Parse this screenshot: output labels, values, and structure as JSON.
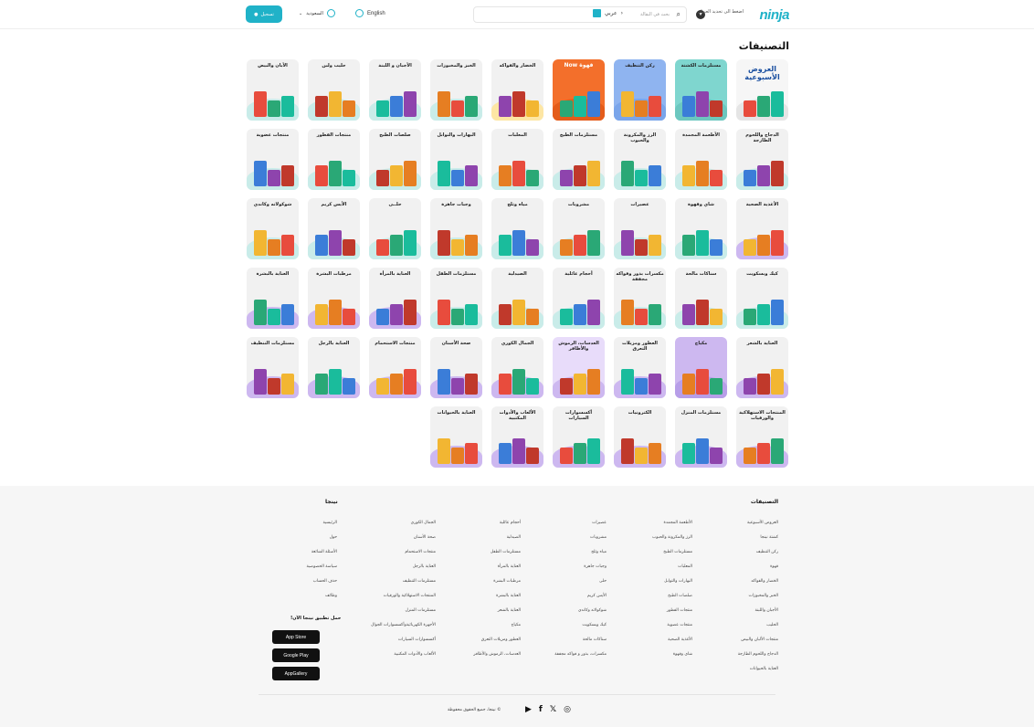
{
  "header": {
    "logo": "ninja",
    "address_prompt": "اضغط الى تحديد العنوان",
    "search_placeholder": "بحث في البقالة",
    "lang_ar": "عربي",
    "lang_en": "English",
    "country": "السعودية",
    "login": "تسجيل"
  },
  "page_title": "التصنيفات",
  "categories": [
    {
      "label": "العروض الأسبوعية",
      "bg": "#f6f6f6",
      "shape": "#e5e5e5",
      "special": "weekly"
    },
    {
      "label": "مستلزمات الكشتة",
      "bg": "#7fd6cf",
      "shape": "#6cc7bf"
    },
    {
      "label": "ركن التنظيف",
      "bg": "#8fb4f0",
      "shape": "#7aa5ea"
    },
    {
      "label": "قهوة Now",
      "bg": "#f36f2b",
      "shape": "#e45c1a",
      "special": "coffee"
    },
    {
      "label": "الخضار والفواكه",
      "bg": "#f1f1f1",
      "shape": "#fde6a4"
    },
    {
      "label": "الخبز والمخبوزات",
      "bg": "#f1f1f1",
      "shape": "#c9ece9"
    },
    {
      "label": "الأجبان و اللبنة",
      "bg": "#f1f1f1",
      "shape": "#c9ece9"
    },
    {
      "label": "حليب ولبن",
      "bg": "#f1f1f1",
      "shape": "#c9ece9"
    },
    {
      "label": "الأبان والبيض",
      "bg": "#f1f1f1",
      "shape": "#c9ece9"
    },
    {
      "label": "الدجاج واللحوم الطازجة",
      "bg": "#f1f1f1",
      "shape": "#c9ece9"
    },
    {
      "label": "الأطعمة المجمدة",
      "bg": "#f1f1f1",
      "shape": "#c9ece9"
    },
    {
      "label": "الرز والمكرونة والحبوب",
      "bg": "#f1f1f1",
      "shape": "#c9ece9"
    },
    {
      "label": "مستلزمات الطبخ",
      "bg": "#f1f1f1",
      "shape": "#c9ece9"
    },
    {
      "label": "المعلبات",
      "bg": "#f1f1f1",
      "shape": "#c9ece9"
    },
    {
      "label": "البهارات والتوابل",
      "bg": "#f1f1f1",
      "shape": "#c9ece9"
    },
    {
      "label": "صلصات الطبخ",
      "bg": "#f1f1f1",
      "shape": "#c9ece9"
    },
    {
      "label": "منتجات الفطور",
      "bg": "#f1f1f1",
      "shape": "#c9ece9"
    },
    {
      "label": "منتجات عضوية",
      "bg": "#f1f1f1",
      "shape": "#c9ece9"
    },
    {
      "label": "الأغذية الصحية",
      "bg": "#f1f1f1",
      "shape": "#cdb8f0"
    },
    {
      "label": "شاي وقهوة",
      "bg": "#f1f1f1",
      "shape": "#c9ece9"
    },
    {
      "label": "عصيرات",
      "bg": "#f1f1f1",
      "shape": "#c9ece9"
    },
    {
      "label": "مشروبات",
      "bg": "#f1f1f1",
      "shape": "#c9ece9"
    },
    {
      "label": "مياه وثلج",
      "bg": "#f1f1f1",
      "shape": "#c9ece9"
    },
    {
      "label": "وجبات جاهزة",
      "bg": "#f1f1f1",
      "shape": "#c9ece9"
    },
    {
      "label": "حلــى",
      "bg": "#f1f1f1",
      "shape": "#c9ece9"
    },
    {
      "label": "الأيس كريم",
      "bg": "#f1f1f1",
      "shape": "#c9ece9"
    },
    {
      "label": "شوكولاته وكاندي",
      "bg": "#f1f1f1",
      "shape": "#c9ece9"
    },
    {
      "label": "كيك وبسكويت",
      "bg": "#f1f1f1",
      "shape": "#c9ece9"
    },
    {
      "label": "سناكات مالحة",
      "bg": "#f1f1f1",
      "shape": "#c9ece9"
    },
    {
      "label": "مكسرات بذور وفواكه مجففة",
      "bg": "#f1f1f1",
      "shape": "#c9ece9"
    },
    {
      "label": "أحجام عائلية",
      "bg": "#f1f1f1",
      "shape": "#c9ece9"
    },
    {
      "label": "الصيدلية",
      "bg": "#f1f1f1",
      "shape": "#c9ece9"
    },
    {
      "label": "مستلزمات الطفل",
      "bg": "#f1f1f1",
      "shape": "#c9ece9"
    },
    {
      "label": "العناية بالمرأة",
      "bg": "#f1f1f1",
      "shape": "#cdb8f0"
    },
    {
      "label": "مرطبات البشرة",
      "bg": "#f1f1f1",
      "shape": "#cdb8f0"
    },
    {
      "label": "العناية بالبشرة",
      "bg": "#f1f1f1",
      "shape": "#cdb8f0"
    },
    {
      "label": "العناية بالشعر",
      "bg": "#f1f1f1",
      "shape": "#cdb8f0"
    },
    {
      "label": "مكياج",
      "bg": "#cdb8f0",
      "shape": "#b79ee8"
    },
    {
      "label": "العطور ومزيلات التعرق",
      "bg": "#f1f1f1",
      "shape": "#cdb8f0"
    },
    {
      "label": "العدسات، الرموش والأظافر",
      "bg": "#e8dcfa",
      "shape": "#cdb8f0"
    },
    {
      "label": "الجمال الكوري",
      "bg": "#f1f1f1",
      "shape": "#cdb8f0"
    },
    {
      "label": "صحة الأسنان",
      "bg": "#f1f1f1",
      "shape": "#cdb8f0"
    },
    {
      "label": "منتجات الاستحمام",
      "bg": "#f1f1f1",
      "shape": "#cdb8f0"
    },
    {
      "label": "العناية بالرجل",
      "bg": "#f1f1f1",
      "shape": "#cdb8f0"
    },
    {
      "label": "مستلزمات التنظيف",
      "bg": "#f1f1f1",
      "shape": "#cdb8f0"
    },
    {
      "label": "المنتجات الاستهلاكية والورقيات",
      "bg": "#f1f1f1",
      "shape": "#cdb8f0"
    },
    {
      "label": "مستلزمات المنزل",
      "bg": "#f1f1f1",
      "shape": "#cdb8f0"
    },
    {
      "label": "الكترونيات",
      "bg": "#f1f1f1",
      "shape": "#cdb8f0"
    },
    {
      "label": "أكسسوارات السيارات",
      "bg": "#f1f1f1",
      "shape": "#cdb8f0"
    },
    {
      "label": "الألعاب والأدوات المكتبية",
      "bg": "#f1f1f1",
      "shape": "#cdb8f0"
    },
    {
      "label": "العناية بالحيوانات",
      "bg": "#f1f1f1",
      "shape": "#cdb8f0"
    }
  ],
  "footer": {
    "categories_heading": "التصنيفات",
    "ninja_heading": "نينجا",
    "col1": [
      "العروض الأسبوعية",
      "كشتة نينجا",
      "ركن التنظيف",
      "قهوة",
      "الخضار والفواكه",
      "الخبز والمخبوزات",
      "الأجبان واللبنة",
      "الحليب",
      "منتجات الألبان والبيض",
      "الدجاج واللحوم الطازجة",
      "العناية بالحيوانات"
    ],
    "col2": [
      "الأطعمة المجمدة",
      "الرز والمكرونة والحبوب",
      "مستلزمات الطبخ",
      "المعلبات",
      "البهارات والتوابل",
      "صلصات الطبخ",
      "منتجات الفطور",
      "منتجات عضوية",
      "الأغذية الصحية",
      "شاي وقهوة"
    ],
    "col3": [
      "عصيرات",
      "مشروبات",
      "مياه وثلج",
      "وجبات جاهزة",
      "حلى",
      "الأيس كريم",
      "شوكولاته وكاندي",
      "كيك وبسكويت",
      "سناكات مالحة",
      "مكسرات، بذور و فواكه مجففة"
    ],
    "col4": [
      "أحجام عائلية",
      "الصيدلية",
      "مستلزمات الطفل",
      "العناية بالمرأة",
      "مرطبات البشرة",
      "العناية بالبشرة",
      "العناية بالشعر",
      "مكياج",
      "العطور ومزيلات التعرق",
      "العدسات، الرموش والأظافر"
    ],
    "col5": [
      "الجمال الكوري",
      "صحة الأسنان",
      "منتجات الاستحمام",
      "العناية بالرجل",
      "مستلزمات التنظيف",
      "المنتجات الاستهلاكية والورقيات",
      "مستلزمات المنزل",
      "الأجهزة الكهربائيةوأكسسوارات الجوال",
      "أكسسوارات السيارات",
      "الألعاب والأدوات المكتبية"
    ],
    "col6": [
      "الرئيسية",
      "حول",
      "الأسئلة الشائعة",
      "سياسة الخصوصية",
      "حذف الحساب",
      "وظائف"
    ],
    "download_heading": "حمل تطبيق نينجا الآن!",
    "app_store": "App Store",
    "google_play": "Google Play",
    "app_gallery": "AppGallery",
    "copyright": "© نينجا، جميع الحقوق محفوظة"
  }
}
